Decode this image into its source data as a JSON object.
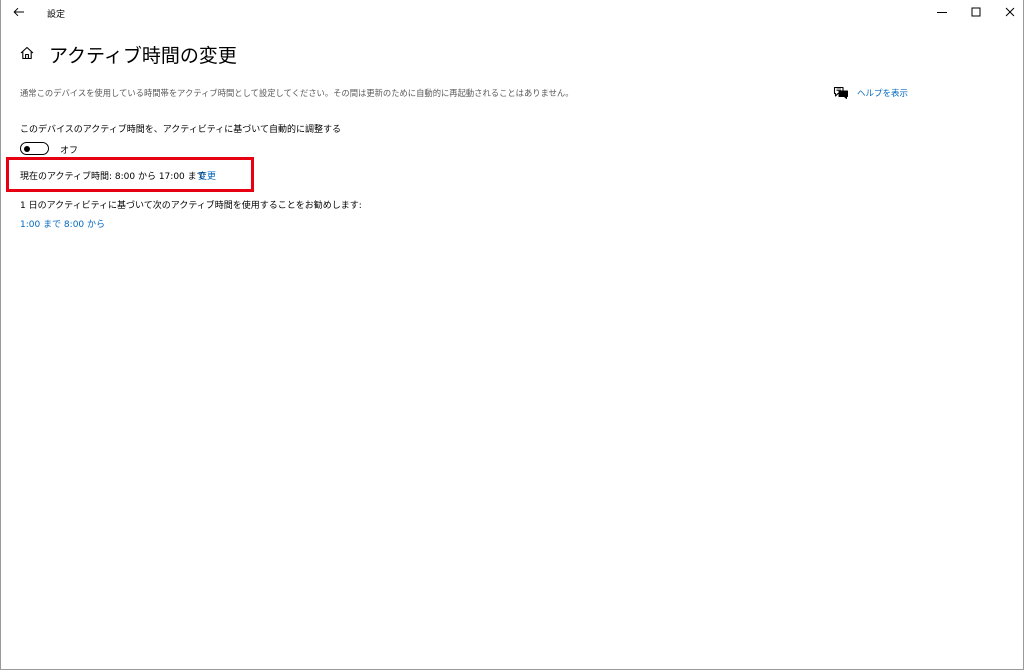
{
  "titlebar": {
    "app_title": "設定",
    "back_icon": "arrow-left-icon",
    "controls": [
      "minimize-icon",
      "maximize-icon",
      "close-icon"
    ]
  },
  "header": {
    "home_icon": "home-icon",
    "title": "アクティブ時間の変更"
  },
  "description": "通常このデバイスを使用している時間帯をアクティブ時間として設定してください。その間は更新のために自動的に再起動されることはありません。",
  "help": {
    "icon": "chat-bubble-icon",
    "label": "ヘルプを表示"
  },
  "auto_adjust": {
    "label": "このデバイスのアクティブ時間を、アクティビティに基づいて自動的に調整する",
    "state_label": "オフ",
    "is_on": false
  },
  "current_hours": {
    "text": "現在のアクティブ時間: 8:00 から 17:00 まで",
    "change_label": "変更"
  },
  "suggestion": {
    "label": "1 日のアクティビティに基づいて次のアクティブ時間を使用することをお勧めします:",
    "link": "1:00 まで 8:00 から"
  },
  "colors": {
    "accent": "#0067c0",
    "highlight": "#e60012",
    "secondary_text": "#5a5a5a"
  }
}
